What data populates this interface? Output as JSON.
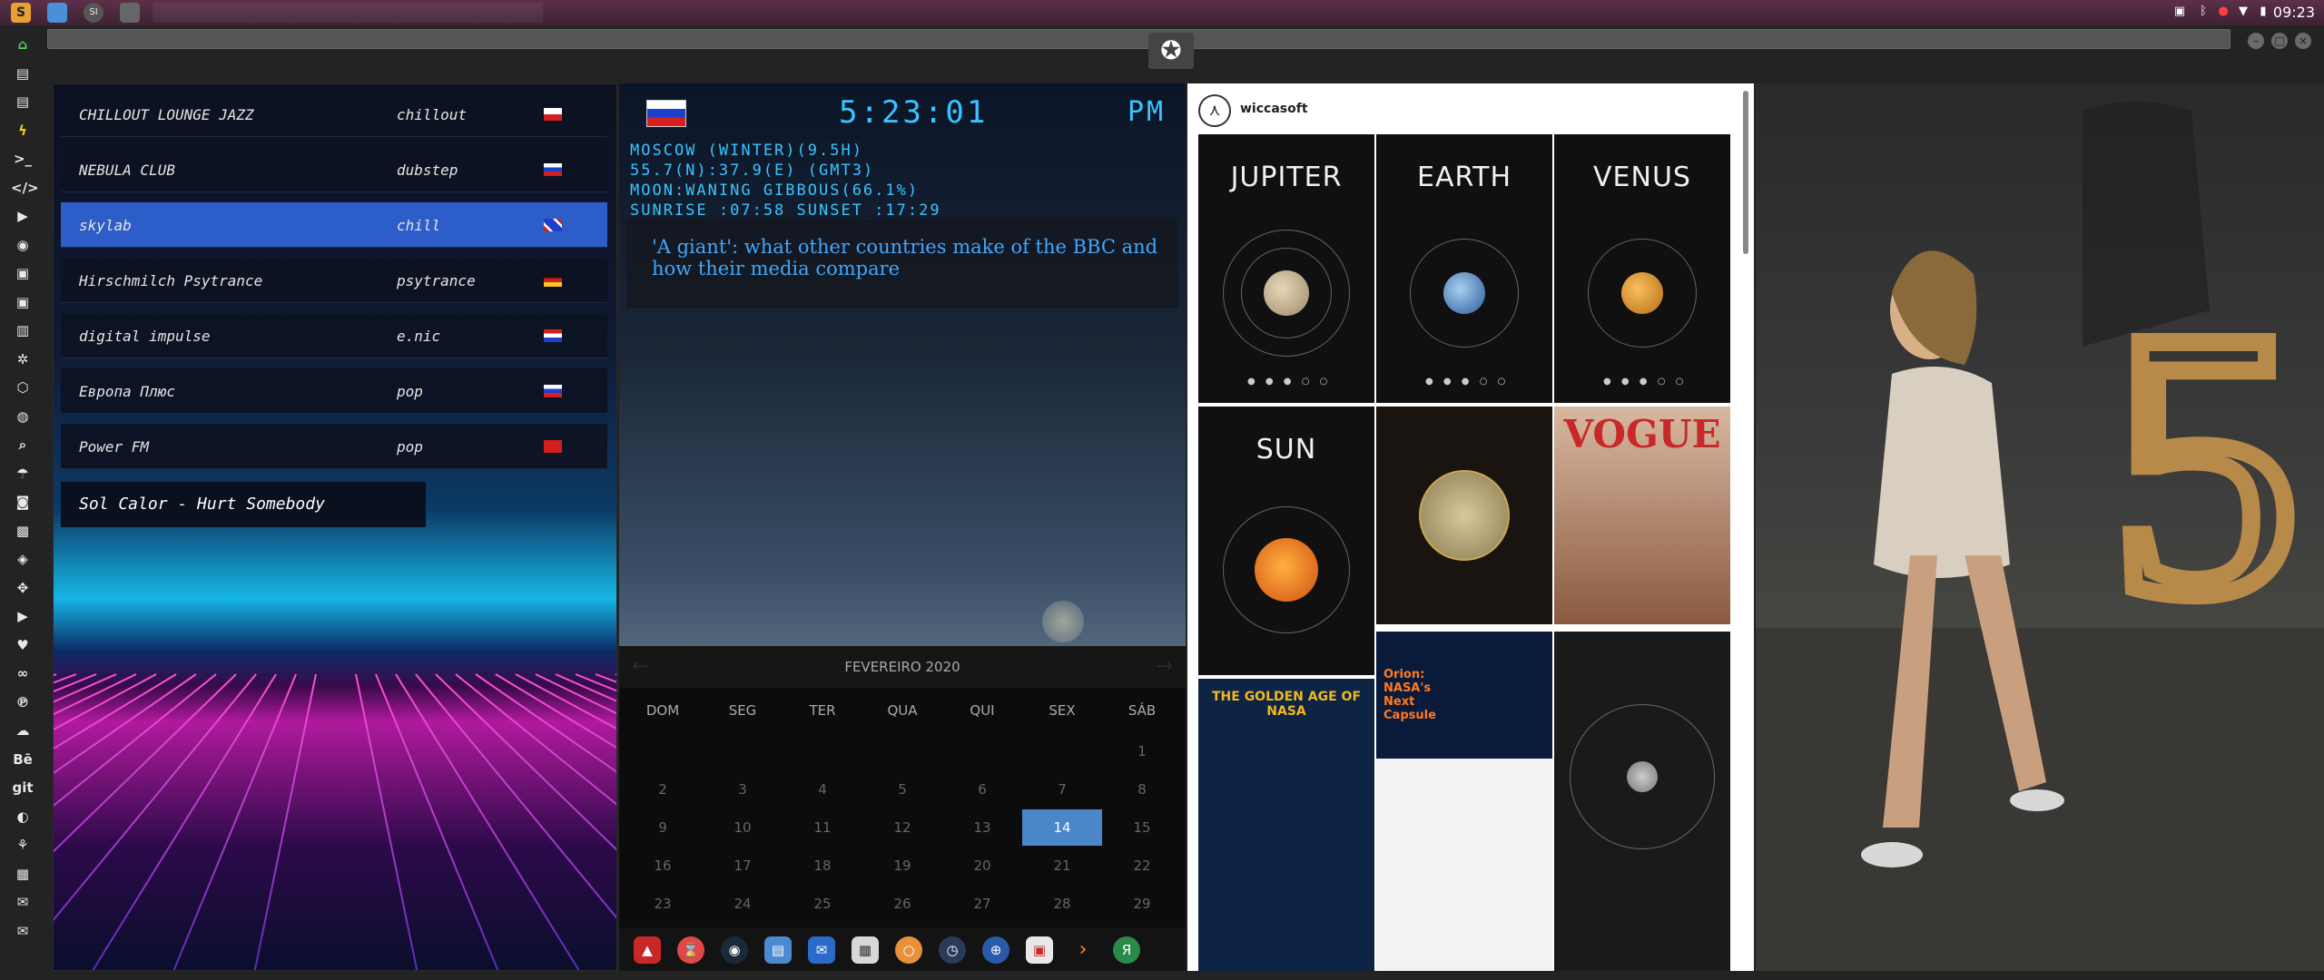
{
  "system": {
    "clock": "09:23"
  },
  "radio": {
    "stations": [
      {
        "name": "CHILLOUT LOUNGE JAZZ",
        "genre": "chillout",
        "active": false
      },
      {
        "name": "NEBULA CLUB",
        "genre": "dubstep",
        "active": false
      },
      {
        "name": "skylab",
        "genre": "chill",
        "active": true
      },
      {
        "name": "Hirschmilch Psytrance",
        "genre": "psytrance",
        "active": false
      },
      {
        "name": "digital impulse",
        "genre": "e.nic",
        "active": false
      },
      {
        "name": "Европа Плюс",
        "genre": "pop",
        "active": false
      },
      {
        "name": "Power FM",
        "genre": "pop",
        "active": false
      }
    ],
    "now_playing": "Sol Calor - Hurt Somebody"
  },
  "clock_widget": {
    "time": "5:23:01",
    "ampm": "PM",
    "lines": [
      "MOSCOW (WINTER)(9.5H)",
      "55.7(N):37.9(E) (GMT3)",
      "MOON:WANING GIBBOUS(66.1%)",
      "SUNRISE_:07:58 SUNSET_:17:29"
    ]
  },
  "news": {
    "headline": "'A giant': what other countries make of the BBC and how their media compare"
  },
  "calendar": {
    "title": "FEVEREIRO 2020",
    "weekdays": [
      "DOM",
      "SEG",
      "TER",
      "QUA",
      "QUI",
      "SEX",
      "SÁB"
    ],
    "weeks": [
      [
        "",
        "",
        "",
        "",
        "",
        "",
        "1"
      ],
      [
        "2",
        "3",
        "4",
        "5",
        "6",
        "7",
        "8"
      ],
      [
        "9",
        "10",
        "11",
        "12",
        "13",
        "14",
        "15"
      ],
      [
        "16",
        "17",
        "18",
        "19",
        "20",
        "21",
        "22"
      ],
      [
        "23",
        "24",
        "25",
        "26",
        "27",
        "28",
        "29"
      ]
    ],
    "today": "14"
  },
  "instagram": {
    "username": "wiccasoft",
    "tiles": [
      {
        "title": "JUPITER"
      },
      {
        "title": "EARTH"
      },
      {
        "title": "VENUS"
      },
      {
        "title": "SUN"
      },
      {
        "title": ""
      },
      {
        "title": "VOGUE"
      },
      {
        "title": "THE GOLDEN AGE OF NASA"
      },
      {
        "title": "Orion: NASA's Next Capsule"
      },
      {
        "title": ""
      }
    ]
  },
  "left_dock_icons": [
    "home-icon",
    "document-icon",
    "document-icon",
    "bolt-icon",
    "terminal-icon",
    "code-icon",
    "play-icon",
    "disc-icon",
    "image-icon",
    "image-icon",
    "book-icon",
    "settings-icon",
    "hexagon-icon",
    "globe-icon",
    "search-icon",
    "umbrella-icon",
    "contact-icon",
    "badge-icon",
    "tag-icon",
    "puzzle-icon",
    "youtube-icon",
    "heart-icon",
    "infinity-icon",
    "pinterest-icon",
    "cloud-icon",
    "behance-icon",
    "git-icon",
    "github-icon",
    "network-icon",
    "map-icon",
    "mail-icon",
    "mail-icon"
  ],
  "left_dock_labels": {
    "behance": "Bē",
    "git": "git"
  }
}
